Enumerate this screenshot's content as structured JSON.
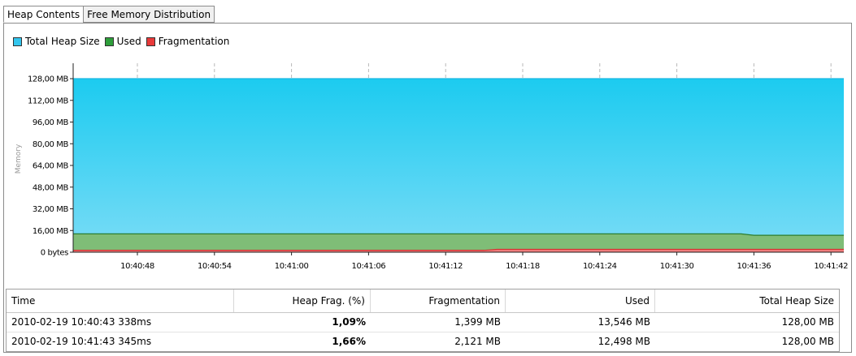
{
  "tabs": [
    "Heap Contents",
    "Free Memory Distribution"
  ],
  "legend": [
    {
      "label": "Total Heap Size",
      "color": "#33c6ee"
    },
    {
      "label": "Used",
      "color": "#2e9e3a"
    },
    {
      "label": "Fragmentation",
      "color": "#e83a3a"
    }
  ],
  "chart_data": {
    "type": "area",
    "ylabel": "Memory",
    "yticks": [
      "0 bytes",
      "16,00 MB",
      "32,00 MB",
      "48,00 MB",
      "64,00 MB",
      "80,00 MB",
      "96,00 MB",
      "112,00 MB",
      "128,00 MB"
    ],
    "ylim": [
      0,
      128
    ],
    "xticks": [
      "10:40:48",
      "10:40:54",
      "10:41:00",
      "10:41:06",
      "10:41:12",
      "10:41:18",
      "10:41:24",
      "10:41:30",
      "10:41:36",
      "10:41:42"
    ],
    "xlim": [
      "10:40:43",
      "10:41:43"
    ],
    "grid": "vertical dashed",
    "series": [
      {
        "name": "Total Heap Size",
        "x": [
          "10:40:43",
          "10:41:43"
        ],
        "values": [
          128,
          128
        ]
      },
      {
        "name": "Used",
        "x": [
          "10:40:43",
          "10:41:35",
          "10:41:36",
          "10:41:43"
        ],
        "values": [
          13.546,
          13.546,
          12.498,
          12.498
        ]
      },
      {
        "name": "Fragmentation",
        "x": [
          "10:40:43",
          "10:41:15",
          "10:41:16",
          "10:41:43"
        ],
        "values": [
          1.399,
          1.399,
          2.121,
          2.121
        ]
      }
    ]
  },
  "table": {
    "columns": [
      "Time",
      "Heap Frag. (%)",
      "Fragmentation",
      "Used",
      "Total Heap Size"
    ],
    "rows": [
      [
        "2010-02-19 10:40:43 338ms",
        "1,09%",
        "1,399 MB",
        "13,546 MB",
        "128,00 MB"
      ],
      [
        "2010-02-19 10:41:43 345ms",
        "1,66%",
        "2,121 MB",
        "12,498 MB",
        "128,00 MB"
      ]
    ]
  }
}
